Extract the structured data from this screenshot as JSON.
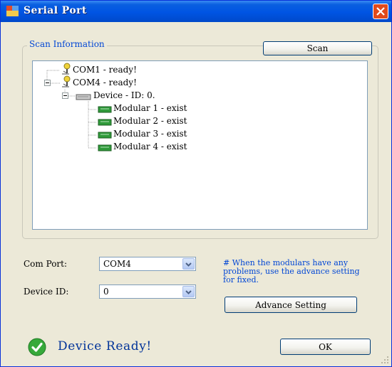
{
  "window": {
    "title": "Serial Port"
  },
  "scan_group": {
    "label": "Scan Information",
    "scan_button": "Scan",
    "tree": [
      {
        "label": "COM1 - ready!"
      },
      {
        "label": "COM4 - ready!"
      },
      {
        "label": "Device - ID: 0."
      },
      {
        "label": "Modular 1 - exist"
      },
      {
        "label": "Modular 2 - exist"
      },
      {
        "label": "Modular 3 - exist"
      },
      {
        "label": "Modular 4 - exist"
      }
    ]
  },
  "settings": {
    "com_port_label": "Com Port:",
    "com_port_value": "COM4",
    "device_id_label": "Device ID:",
    "device_id_value": "0",
    "note": "# When the modulars have any problems, use the advance setting for fixed.",
    "advance_button": "Advance Setting"
  },
  "status": {
    "text": "Device Ready!",
    "ok_button": "OK"
  },
  "colors": {
    "titlebar": "#0054e3",
    "accent_text": "#0046d5",
    "status_text": "#003399",
    "module_icon": "#2f9a3a"
  }
}
